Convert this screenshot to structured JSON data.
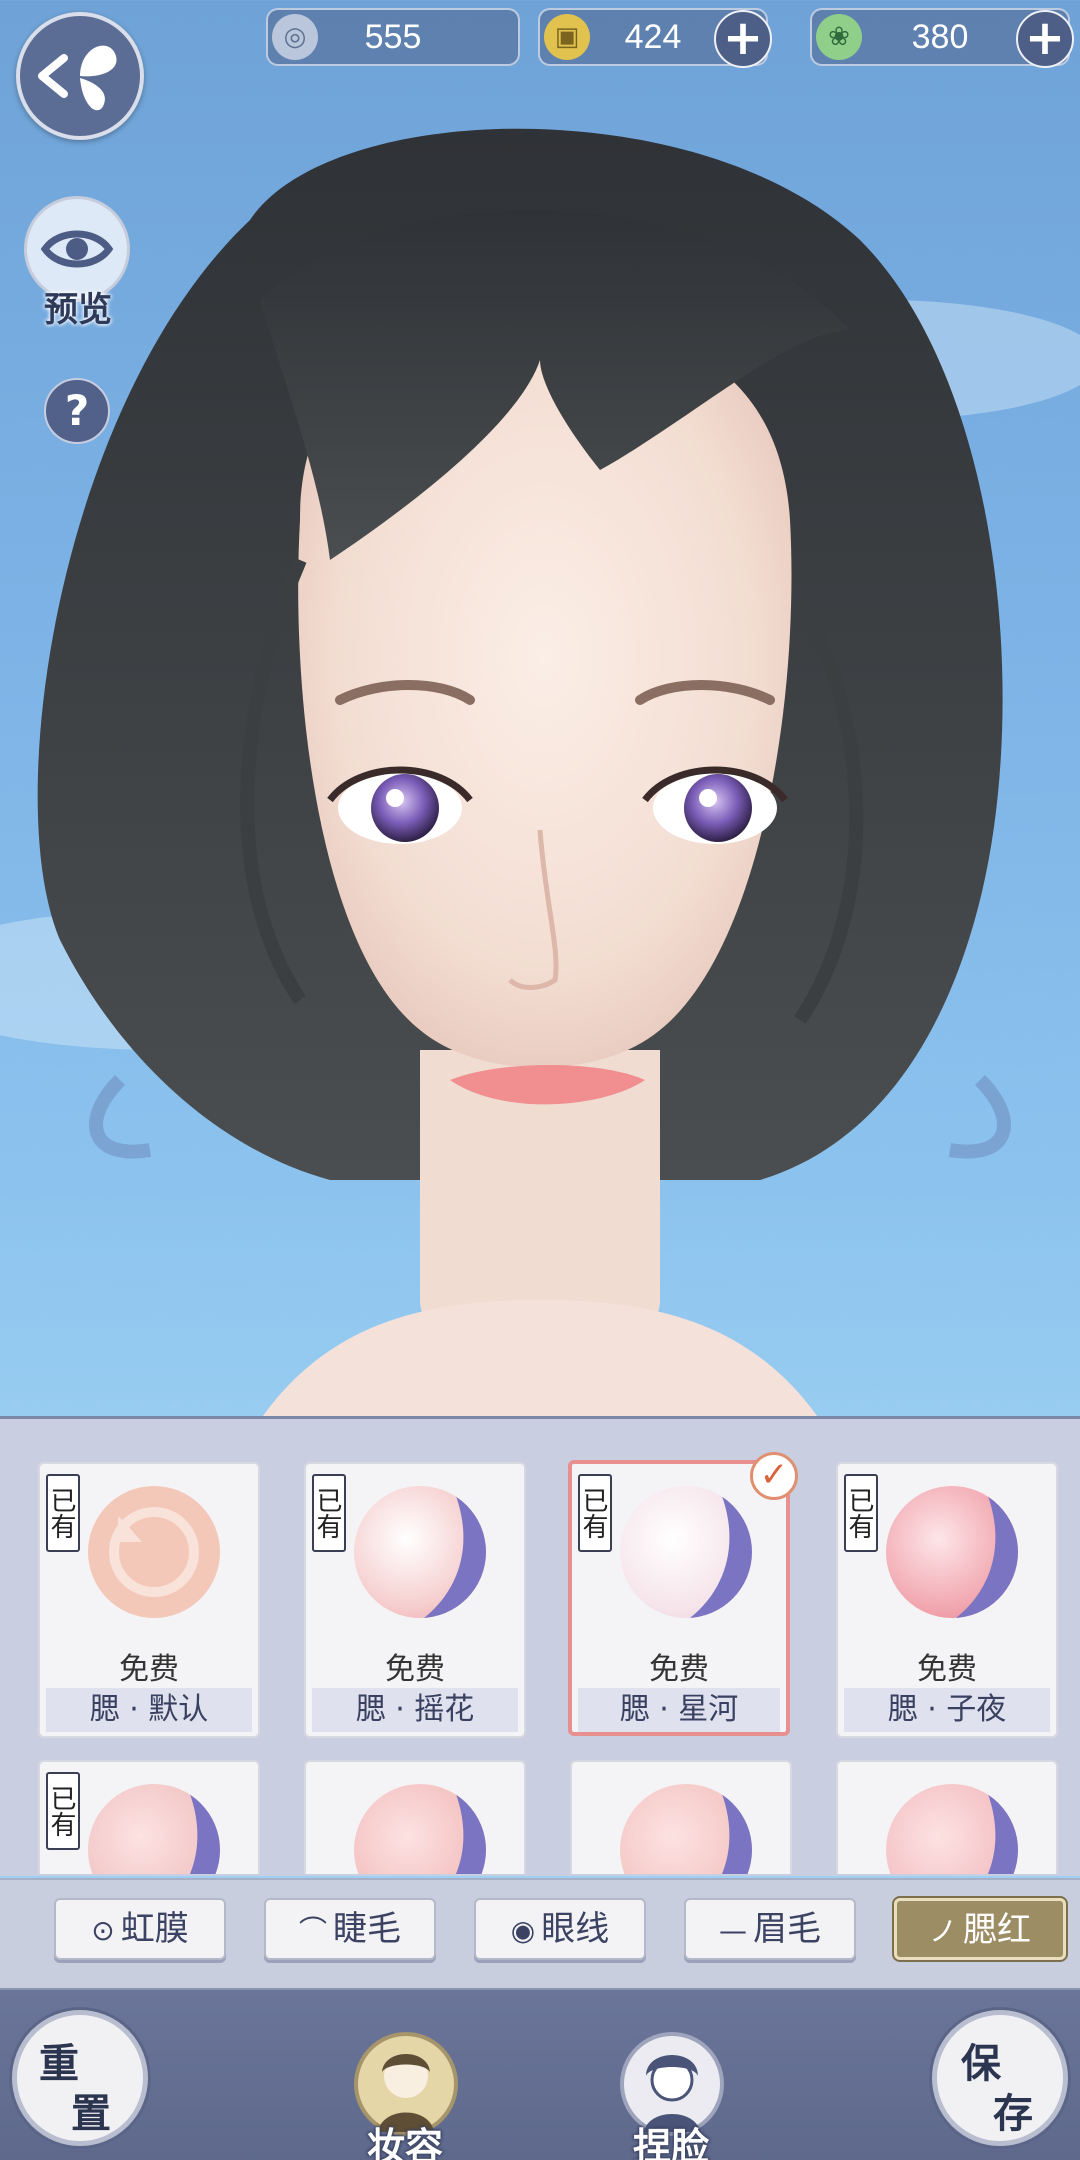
{
  "currencies": [
    {
      "name": "silver-coin",
      "value": "555",
      "has_plus": false,
      "color": "#b9c6dc"
    },
    {
      "name": "gold-coin",
      "value": "424",
      "has_plus": true,
      "color": "#e2c24e"
    },
    {
      "name": "jade-token",
      "value": "380",
      "has_plus": true,
      "color": "#8fcf8a"
    }
  ],
  "plus_symbol": "+",
  "left_controls": {
    "preview_label": "预览",
    "help_symbol": "?"
  },
  "makeup_items": [
    {
      "owned_badge": "已有",
      "price": "免费",
      "name": "腮 · 默认",
      "selected": false,
      "swatch": "#f3c8b8",
      "is_default": true
    },
    {
      "owned_badge": "已有",
      "price": "免费",
      "name": "腮 · 摇花",
      "selected": false,
      "swatch": "#f6cfcf",
      "is_default": false
    },
    {
      "owned_badge": "已有",
      "price": "免费",
      "name": "腮 · 星河",
      "selected": true,
      "swatch": "#f5e3ea",
      "is_default": false
    },
    {
      "owned_badge": "已有",
      "price": "免费",
      "name": "腮 · 子夜",
      "selected": false,
      "swatch": "#f2a9b2",
      "is_default": false
    },
    {
      "owned_badge": "已有",
      "price": "",
      "name": "",
      "selected": false,
      "swatch": "#f2c7c7",
      "is_default": false
    },
    {
      "owned_badge": "",
      "price": "",
      "name": "",
      "selected": false,
      "swatch": "#f4c2c2",
      "is_default": false
    },
    {
      "owned_badge": "",
      "price": "",
      "name": "",
      "selected": false,
      "swatch": "#f4c8c6",
      "is_default": false
    },
    {
      "owned_badge": "",
      "price": "",
      "name": "",
      "selected": false,
      "swatch": "#f4c2c6",
      "is_default": false
    }
  ],
  "selected_check": "✓",
  "tabs": [
    {
      "icon": "⊙",
      "label": "虹膜",
      "active": false
    },
    {
      "icon": "⌒",
      "label": "睫毛",
      "active": false
    },
    {
      "icon": "◉",
      "label": "眼线",
      "active": false
    },
    {
      "icon": "—",
      "label": "眉毛",
      "active": false
    },
    {
      "icon": "ノ",
      "label": "腮红",
      "active": true
    }
  ],
  "bottom_nav": {
    "reset": {
      "line1": "重",
      "line2": "置"
    },
    "makeup": {
      "label": "妆容"
    },
    "face": {
      "label": "捏脸"
    },
    "save": {
      "line1": "保",
      "line2": "存"
    }
  },
  "colors": {
    "accent_gold": "#9c8d65",
    "panel_bg": "#c9cfe0",
    "nav_bg": "#5e698c",
    "selected_border": "#e89090"
  }
}
